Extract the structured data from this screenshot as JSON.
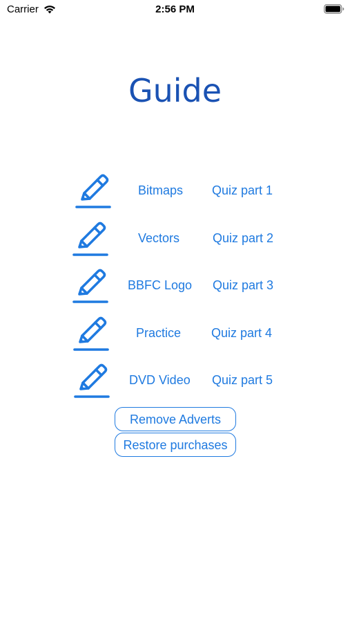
{
  "status_bar": {
    "carrier": "Carrier",
    "time": "2:56 PM",
    "wifi_icon": "wifi-icon",
    "battery_icon": "battery-icon"
  },
  "page": {
    "title": "Guide"
  },
  "rows": [
    {
      "topic": "Bitmaps",
      "quiz": "Quiz part 1",
      "icon": "pencil-icon"
    },
    {
      "topic": "Vectors",
      "quiz": "Quiz part 2",
      "icon": "pencil-icon"
    },
    {
      "topic": "BBFC Logo",
      "quiz": "Quiz part 3",
      "icon": "pencil-icon"
    },
    {
      "topic": "Practice",
      "quiz": "Quiz part 4",
      "icon": "pencil-icon"
    },
    {
      "topic": "DVD Video",
      "quiz": "Quiz part 5",
      "icon": "pencil-icon"
    }
  ],
  "buttons": {
    "remove_adverts": "Remove Adverts",
    "restore_purchases": "Restore purchases"
  },
  "colors": {
    "title": "#1a52b3",
    "accent": "#1f7ae0"
  }
}
